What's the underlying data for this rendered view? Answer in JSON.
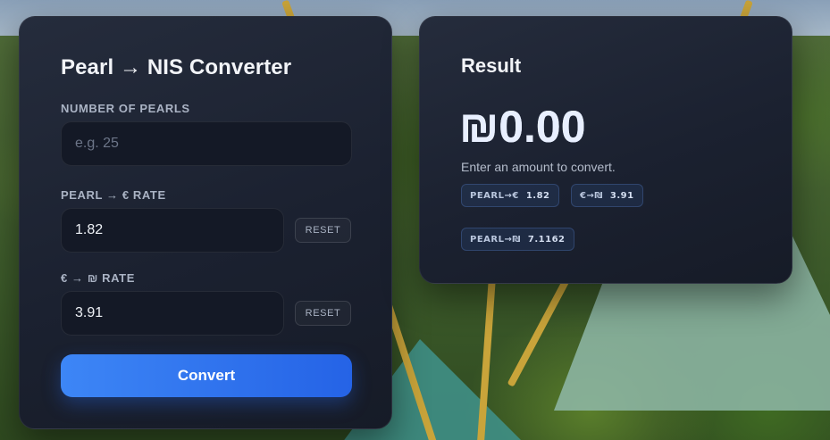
{
  "converter": {
    "title": "Pearl → NIS Converter",
    "pearls_label": "NUMBER OF PEARLS",
    "pearls_placeholder": "e.g. 25",
    "pearls_value": "",
    "pearl_eur_label": "PEARL → € RATE",
    "pearl_eur_value": "1.82",
    "eur_ils_label": "€ → ₪ RATE",
    "eur_ils_value": "3.91",
    "reset_label": "RESET",
    "convert_label": "Convert"
  },
  "result": {
    "title": "Result",
    "value": "₪0.00",
    "note": "Enter an amount to convert.",
    "pills": [
      {
        "label": "PEARL→€",
        "value": "1.82"
      },
      {
        "label": "€→₪",
        "value": "3.91"
      },
      {
        "label": "PEARL→₪",
        "value": "7.1162"
      }
    ]
  },
  "colors": {
    "accent": "#2563e6",
    "card_bg": "#1b2130",
    "text": "#f2f4f8"
  }
}
